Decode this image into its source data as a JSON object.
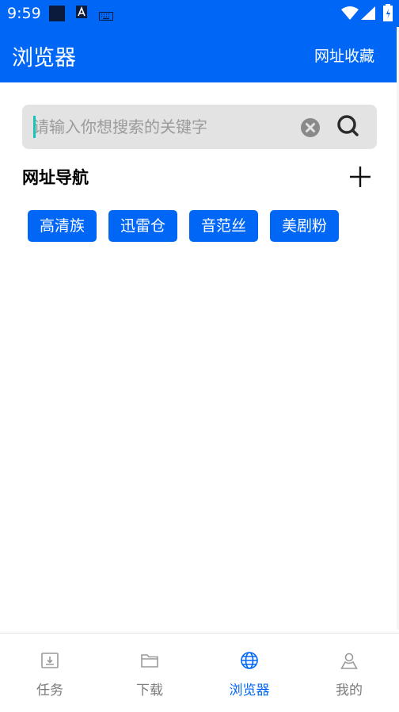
{
  "status_bar": {
    "time": "9:59",
    "icons": [
      "app-square-icon",
      "a-badge-icon",
      "keyboard-icon",
      "wifi-icon",
      "signal-icon",
      "battery-icon"
    ]
  },
  "header": {
    "title": "浏览器",
    "action_label": "网址收藏"
  },
  "search": {
    "placeholder": "请输入你想搜索的关键字",
    "value": ""
  },
  "nav_section": {
    "title": "网址导航",
    "items": [
      {
        "label": "高清族"
      },
      {
        "label": "迅雷仓"
      },
      {
        "label": "音范丝"
      },
      {
        "label": "美剧粉"
      }
    ]
  },
  "bottom_nav": {
    "items": [
      {
        "label": "任务",
        "icon": "download-tray-icon",
        "active": false
      },
      {
        "label": "下载",
        "icon": "folder-icon",
        "active": false
      },
      {
        "label": "浏览器",
        "icon": "globe-icon",
        "active": true
      },
      {
        "label": "我的",
        "icon": "user-icon",
        "active": false
      }
    ]
  },
  "colors": {
    "primary": "#0066f5",
    "search_bg": "#e3e3e3",
    "inactive": "#7a7a7a",
    "caret": "#18c4b7"
  }
}
